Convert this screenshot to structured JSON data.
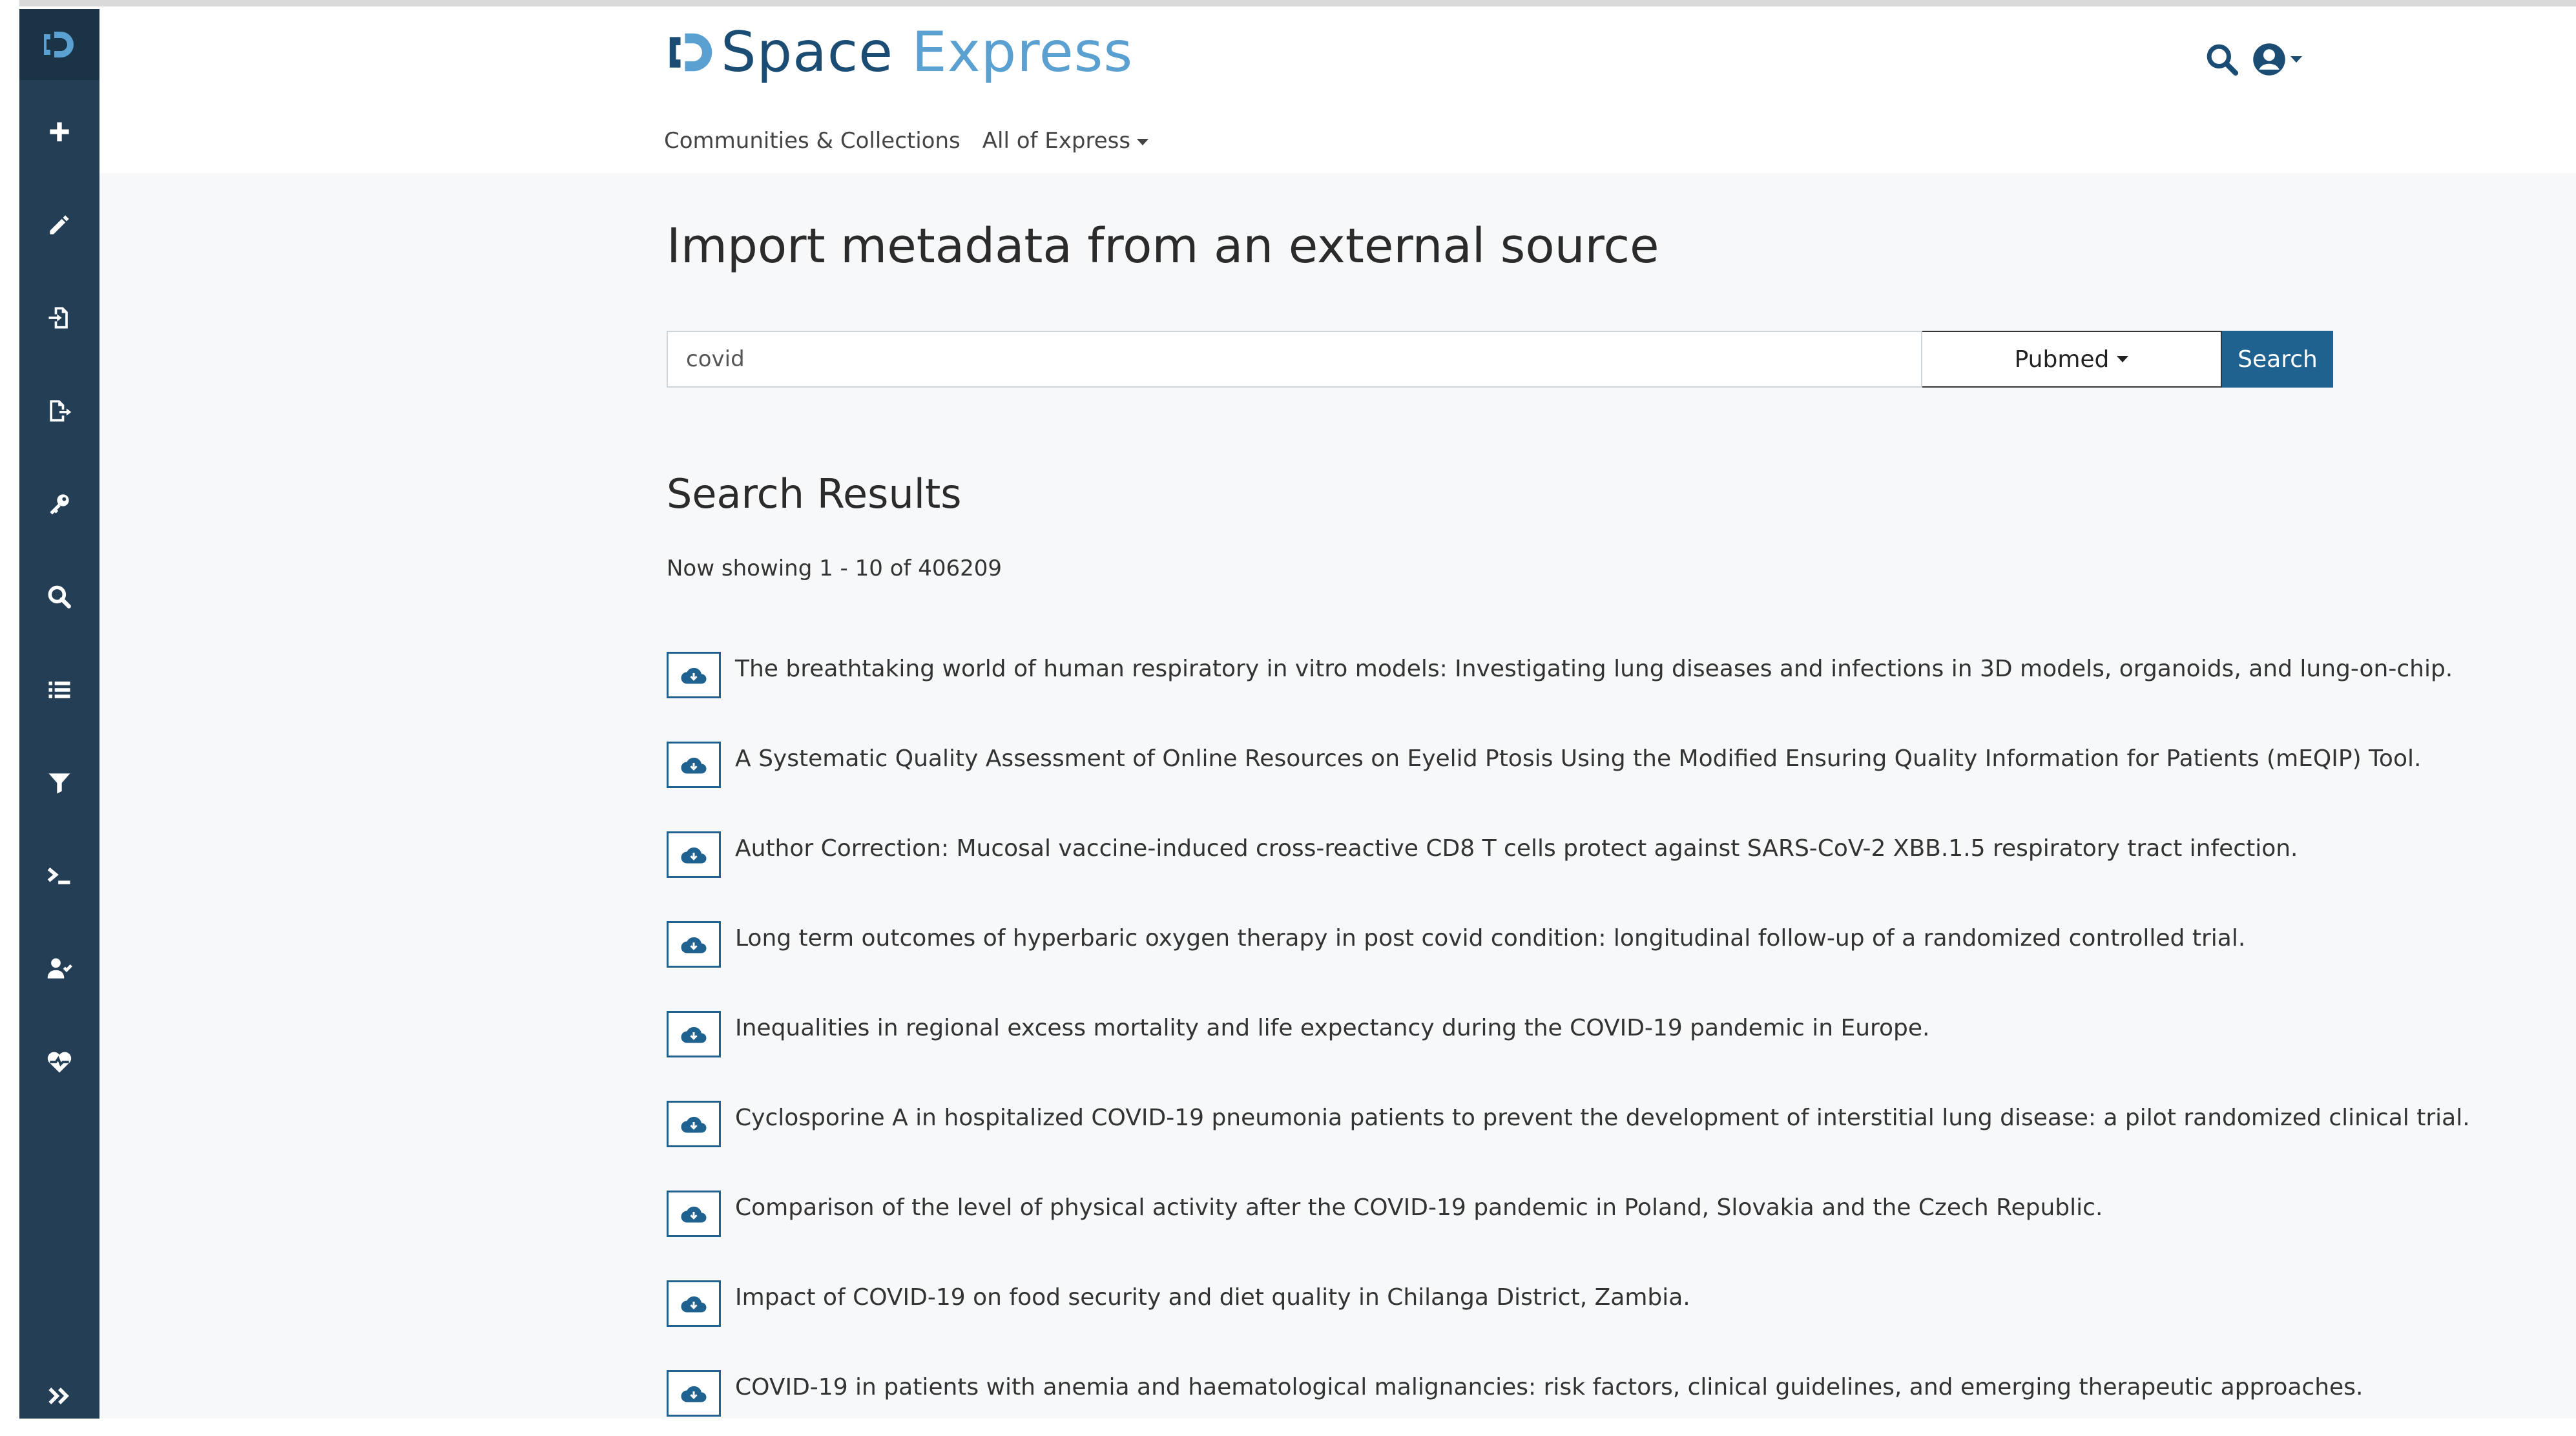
{
  "app": {
    "logo_text_prefix": "Space",
    "logo_text_suffix": "Express"
  },
  "sidebar": {
    "items": [
      {
        "name": "plus-icon"
      },
      {
        "name": "pencil-icon"
      },
      {
        "name": "import-icon"
      },
      {
        "name": "export-icon"
      },
      {
        "name": "key-icon"
      },
      {
        "name": "search-icon"
      },
      {
        "name": "list-icon"
      },
      {
        "name": "filter-icon"
      },
      {
        "name": "terminal-icon"
      },
      {
        "name": "user-check-icon"
      },
      {
        "name": "heartbeat-icon"
      },
      {
        "name": "double-chevron-right-icon"
      }
    ],
    "colors": {
      "background": "#243e55",
      "logo_bg": "#1b3346",
      "icon": "#ffffff"
    }
  },
  "header": {
    "nav": [
      {
        "label": "Communities & Collections"
      },
      {
        "label": "All of Express"
      }
    ]
  },
  "main": {
    "title": "Import metadata from an external source",
    "search": {
      "value": "covid",
      "source": "Pubmed",
      "button": "Search"
    },
    "results_heading": "Search Results",
    "count_text": "Now showing 1 - 10 of 406209",
    "results": [
      {
        "title": "The breathtaking world of human respiratory in vitro models: Investigating lung diseases and infections in 3D models, organoids, and lung-on-chip."
      },
      {
        "title": "A Systematic Quality Assessment of Online Resources on Eyelid Ptosis Using the Modified Ensuring Quality Information for Patients (mEQIP) Tool."
      },
      {
        "title": "Author Correction: Mucosal vaccine-induced cross-reactive CD8 T cells protect against SARS-CoV-2 XBB.1.5 respiratory tract infection."
      },
      {
        "title": "Long term outcomes of hyperbaric oxygen therapy in post covid condition: longitudinal follow-up of a randomized controlled trial."
      },
      {
        "title": "Inequalities in regional excess mortality and life expectancy during the COVID-19 pandemic in Europe."
      },
      {
        "title": "Cyclosporine A in hospitalized COVID-19 pneumonia patients to prevent the development of interstitial lung disease: a pilot randomized clinical trial."
      },
      {
        "title": "Comparison of the level of physical activity after the COVID-19 pandemic in Poland, Slovakia and the Czech Republic."
      },
      {
        "title": "Impact of COVID-19 on food security and diet quality in Chilanga District, Zambia."
      },
      {
        "title": "COVID-19 in patients with anemia and haematological malignancies: risk factors, clinical guidelines, and emerging therapeutic approaches."
      }
    ],
    "colors": {
      "primary": "#20628f",
      "page_bg": "#f6f8f9"
    }
  }
}
